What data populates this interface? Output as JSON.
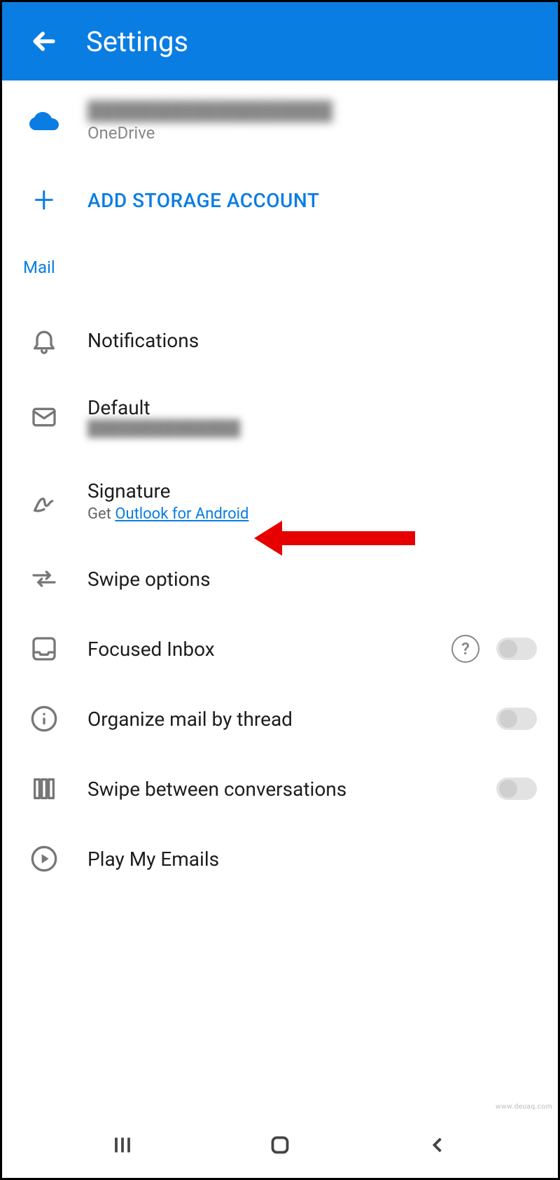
{
  "header": {
    "title": "Settings"
  },
  "account": {
    "email_preview": "███████████████████",
    "service": "OneDrive"
  },
  "add_storage": {
    "label": "ADD STORAGE ACCOUNT"
  },
  "sections": {
    "mail_label": "Mail"
  },
  "rows": {
    "notifications": {
      "title": "Notifications"
    },
    "default": {
      "title": "Default",
      "sub_preview": "██████████████"
    },
    "signature": {
      "title": "Signature",
      "sub_prefix": "Get ",
      "link_text": "Outlook for Android"
    },
    "swipe_options": {
      "title": "Swipe options"
    },
    "focused_inbox": {
      "title": "Focused Inbox",
      "toggle": false
    },
    "organize_thread": {
      "title": "Organize mail by thread",
      "toggle": false
    },
    "swipe_conversations": {
      "title": "Swipe between conversations",
      "toggle": false
    },
    "play_my_emails": {
      "title": "Play My Emails"
    }
  },
  "watermark": "www.deuaq.com"
}
